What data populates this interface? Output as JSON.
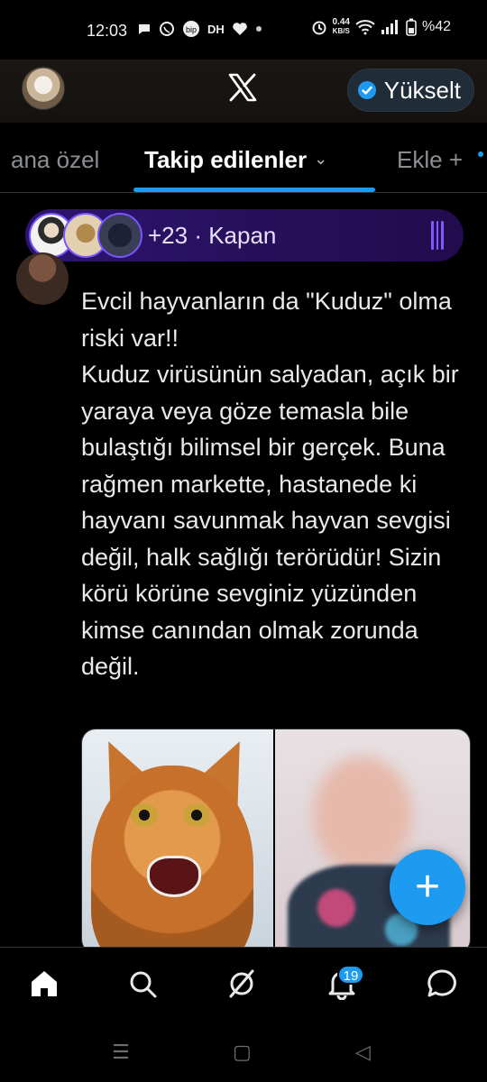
{
  "status_bar": {
    "time": "12:03",
    "notif_icons": [
      "chat-bubble-icon",
      "whatsapp-icon",
      "bip-icon",
      "dh-icon",
      "heart-icon",
      "dot-icon"
    ],
    "dh_label": "DH",
    "net_speed_value": "0.44",
    "net_speed_unit": "KB/S",
    "battery": "%42"
  },
  "header": {
    "logo": "x-logo-icon",
    "upgrade_label": "Yükselt",
    "upgrade_icon": "verified-badge-icon"
  },
  "tabs": {
    "for_you": "ana özel",
    "following": "Takip edilenler",
    "add": "Ekle",
    "add_plus": "+"
  },
  "spaces": {
    "text": "+23 · Kapan"
  },
  "tweet": {
    "text": "Evcil hayvanların da \"Kuduz\" olma riski var!!\nKuduz virüsünün salyadan, açık bir yaraya veya göze temasla bile bulaştığı bilimsel bir gerçek. Buna rağmen markette, hastanede ki hayvanı savunmak hayvan sevgisi değil, halk sağlığı terörüdür! Sizin körü körüne sevginiz yüzünden kimse canından olmak zorunda değil."
  },
  "fab": {
    "label": "+"
  },
  "bottom_nav": {
    "items": [
      "home-icon",
      "search-icon",
      "grok-icon",
      "notifications-icon",
      "messages-icon"
    ],
    "notif_badge": "19"
  },
  "system_nav": {
    "recent": "☰",
    "home": "▢",
    "back": "◁"
  },
  "colors": {
    "accent": "#1d9bf0",
    "spaces_purple": "#7856ff",
    "background": "#000000"
  }
}
